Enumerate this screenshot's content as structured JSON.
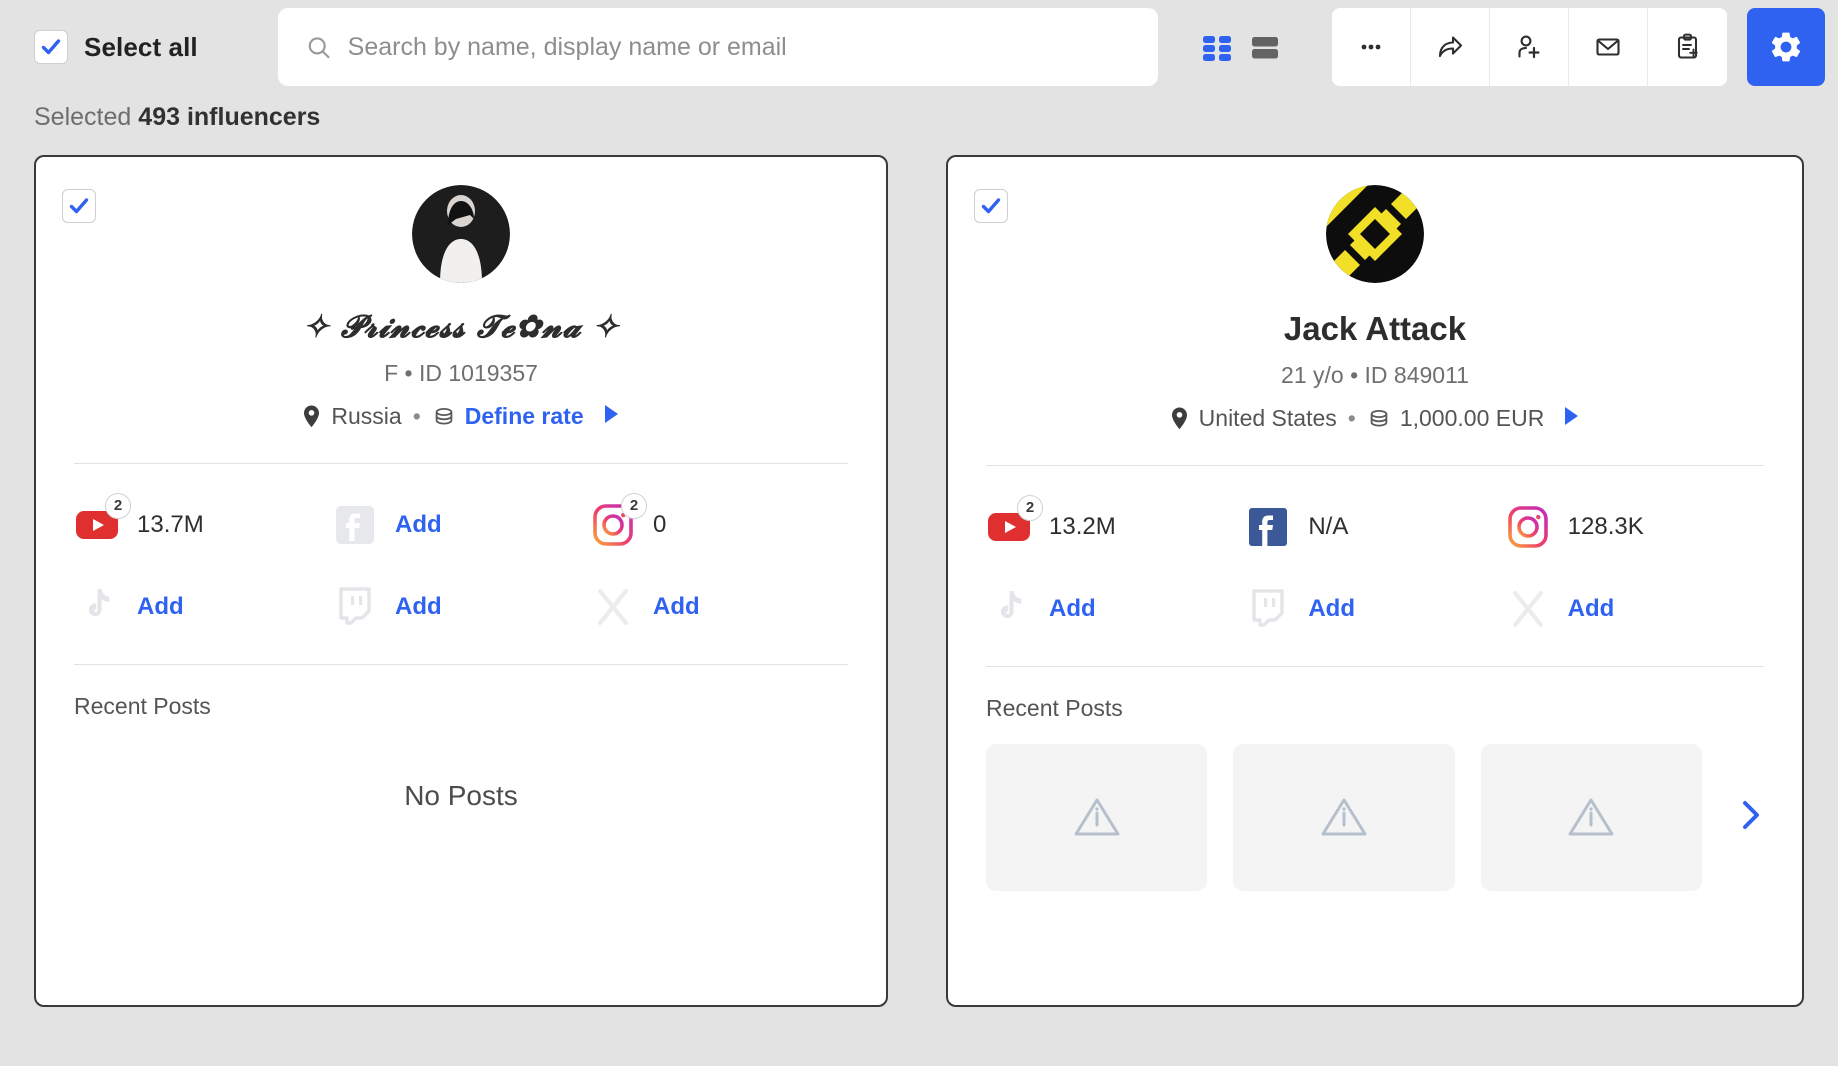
{
  "toolbar": {
    "select_all_label": "Select all",
    "search_placeholder": "Search by name, display name or email",
    "search_value": "",
    "search_icon": "search-icon",
    "grid_view_icon": "grid-view-icon",
    "list_view_icon": "list-view-icon",
    "actions": [
      {
        "name": "more-options-button",
        "icon": "ellipsis-icon"
      },
      {
        "name": "share-button",
        "icon": "share-arrow-icon"
      },
      {
        "name": "add-user-button",
        "icon": "user-plus-icon"
      },
      {
        "name": "email-button",
        "icon": "envelope-icon"
      },
      {
        "name": "add-to-list-button",
        "icon": "clipboard-plus-icon"
      }
    ],
    "settings_icon": "gear-icon",
    "accent_color": "#2f62f0",
    "page_bg": "#e3e3e3"
  },
  "selection": {
    "prefix": "Selected",
    "count_text": "493 influencers"
  },
  "cards": [
    {
      "checked": true,
      "avatar_type": "photo-bw-man",
      "name": "✧ 𝓟𝓻𝓲𝓷𝓬𝓮𝓼𝓼 𝓣𝓮✿𝓷𝓪 ✧",
      "name_style": "script",
      "meta": "F • ID 1019357",
      "location": "Russia",
      "location_separator": "•",
      "rate_label": "Define rate",
      "rate_is_link": true,
      "socials": [
        {
          "network": "youtube",
          "icon": "youtube-icon",
          "state": "active",
          "badge": "2",
          "value": "13.7M",
          "action": null
        },
        {
          "network": "facebook",
          "icon": "facebook-icon",
          "state": "inactive",
          "badge": null,
          "value": null,
          "action": "Add"
        },
        {
          "network": "instagram",
          "icon": "instagram-icon",
          "state": "active",
          "badge": "2",
          "value": "0",
          "action": null
        },
        {
          "network": "tiktok",
          "icon": "tiktok-icon",
          "state": "inactive",
          "badge": null,
          "value": null,
          "action": "Add"
        },
        {
          "network": "twitch",
          "icon": "twitch-icon",
          "state": "inactive",
          "badge": null,
          "value": null,
          "action": "Add"
        },
        {
          "network": "x",
          "icon": "x-twitter-icon",
          "state": "inactive",
          "badge": null,
          "value": null,
          "action": "Add"
        }
      ],
      "recent_posts_title": "Recent Posts",
      "has_posts": false,
      "no_posts_text": "No Posts",
      "posts": []
    },
    {
      "checked": true,
      "avatar_type": "logo-yellow-diamond",
      "name": "Jack Attack",
      "name_style": "bold",
      "meta": "21 y/o • ID 849011",
      "location": "United States",
      "location_separator": "•",
      "rate_label": "1,000.00 EUR",
      "rate_is_link": false,
      "socials": [
        {
          "network": "youtube",
          "icon": "youtube-icon",
          "state": "active",
          "badge": "2",
          "value": "13.2M",
          "action": null
        },
        {
          "network": "facebook",
          "icon": "facebook-icon",
          "state": "active",
          "badge": null,
          "value": "N/A",
          "action": null
        },
        {
          "network": "instagram",
          "icon": "instagram-icon",
          "state": "active",
          "badge": null,
          "value": "128.3K",
          "action": null
        },
        {
          "network": "tiktok",
          "icon": "tiktok-icon",
          "state": "inactive",
          "badge": null,
          "value": null,
          "action": "Add"
        },
        {
          "network": "twitch",
          "icon": "twitch-icon",
          "state": "inactive",
          "badge": null,
          "value": null,
          "action": "Add"
        },
        {
          "network": "x",
          "icon": "x-twitter-icon",
          "state": "inactive",
          "badge": null,
          "value": null,
          "action": "Add"
        }
      ],
      "recent_posts_title": "Recent Posts",
      "has_posts": true,
      "no_posts_text": "",
      "posts": [
        {
          "icon": "warning-triangle-icon"
        },
        {
          "icon": "warning-triangle-icon"
        },
        {
          "icon": "warning-triangle-icon"
        }
      ],
      "posts_next_icon": "chevron-right-icon"
    }
  ]
}
